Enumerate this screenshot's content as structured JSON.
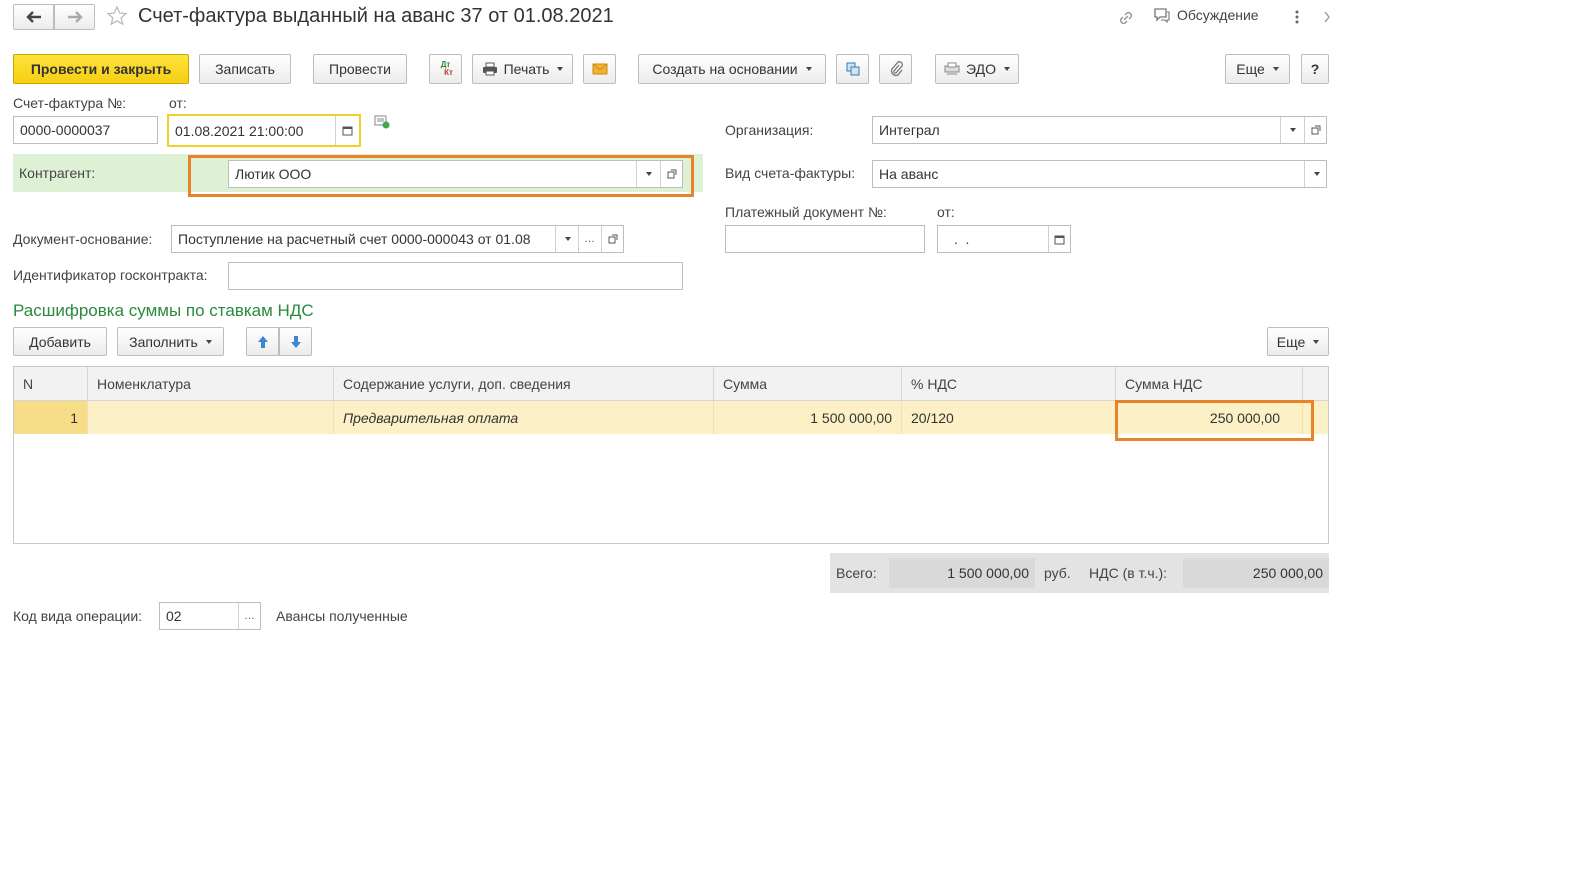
{
  "title": "Счет-фактура выданный на аванс 37 от 01.08.2021",
  "header": {
    "discussion_label": "Обсуждение"
  },
  "toolbar": {
    "post_close_label": "Провести и закрыть",
    "save_label": "Записать",
    "post_label": "Провести",
    "dtkt_label": "Дт Кт",
    "print_label": "Печать",
    "create_based_label": "Создать на основании",
    "edo_label": "ЭДО",
    "more_label": "Еще",
    "help_label": "?"
  },
  "form": {
    "invoice_no_label": "Счет-фактура №:",
    "invoice_no_value": "0000-0000037",
    "date_label": "от:",
    "date_value": "01.08.2021 21:00:00",
    "org_label": "Организация:",
    "org_value": "Интеграл",
    "counterparty_label": "Контрагент:",
    "counterparty_value": "Лютик ООО",
    "invoice_type_label": "Вид счета-фактуры:",
    "invoice_type_value": "На аванс",
    "payment_doc_label": "Платежный документ №:",
    "payment_doc_value": "",
    "payment_date_label": "от:",
    "payment_date_value": " .  .",
    "base_doc_label": "Документ-основание:",
    "base_doc_value": "Поступление на расчетный счет 0000-000043 от 01.08",
    "gov_contract_label": "Идентификатор госконтракта:",
    "gov_contract_value": ""
  },
  "section": {
    "title": "Расшифровка суммы по ставкам НДС",
    "add_label": "Добавить",
    "fill_label": "Заполнить",
    "more_label": "Еще"
  },
  "table": {
    "columns": [
      "N",
      "Номенклатура",
      "Содержание услуги, доп. сведения",
      "Сумма",
      "% НДС",
      "Сумма НДС"
    ],
    "rows": [
      {
        "n": "1",
        "nomenclature": "",
        "content": "Предварительная оплата",
        "sum": "1 500 000,00",
        "vat_rate": "20/120",
        "vat_sum": "250 000,00"
      }
    ]
  },
  "totals": {
    "total_label": "Всего:",
    "total_value": "1 500 000,00",
    "currency": "руб.",
    "vat_label": "НДС (в т.ч.):",
    "vat_value": "250 000,00"
  },
  "operation": {
    "label": "Код вида операции:",
    "code": "02",
    "description": "Авансы полученные"
  },
  "colors": {
    "primary_button": "#f5cf12",
    "highlight_orange": "#e8832a",
    "section_title_green": "#2a8a3e",
    "counterparty_bg": "#dff1d5",
    "selected_row": "#fbf0c6",
    "totals_bg": "#e3e3e3"
  }
}
